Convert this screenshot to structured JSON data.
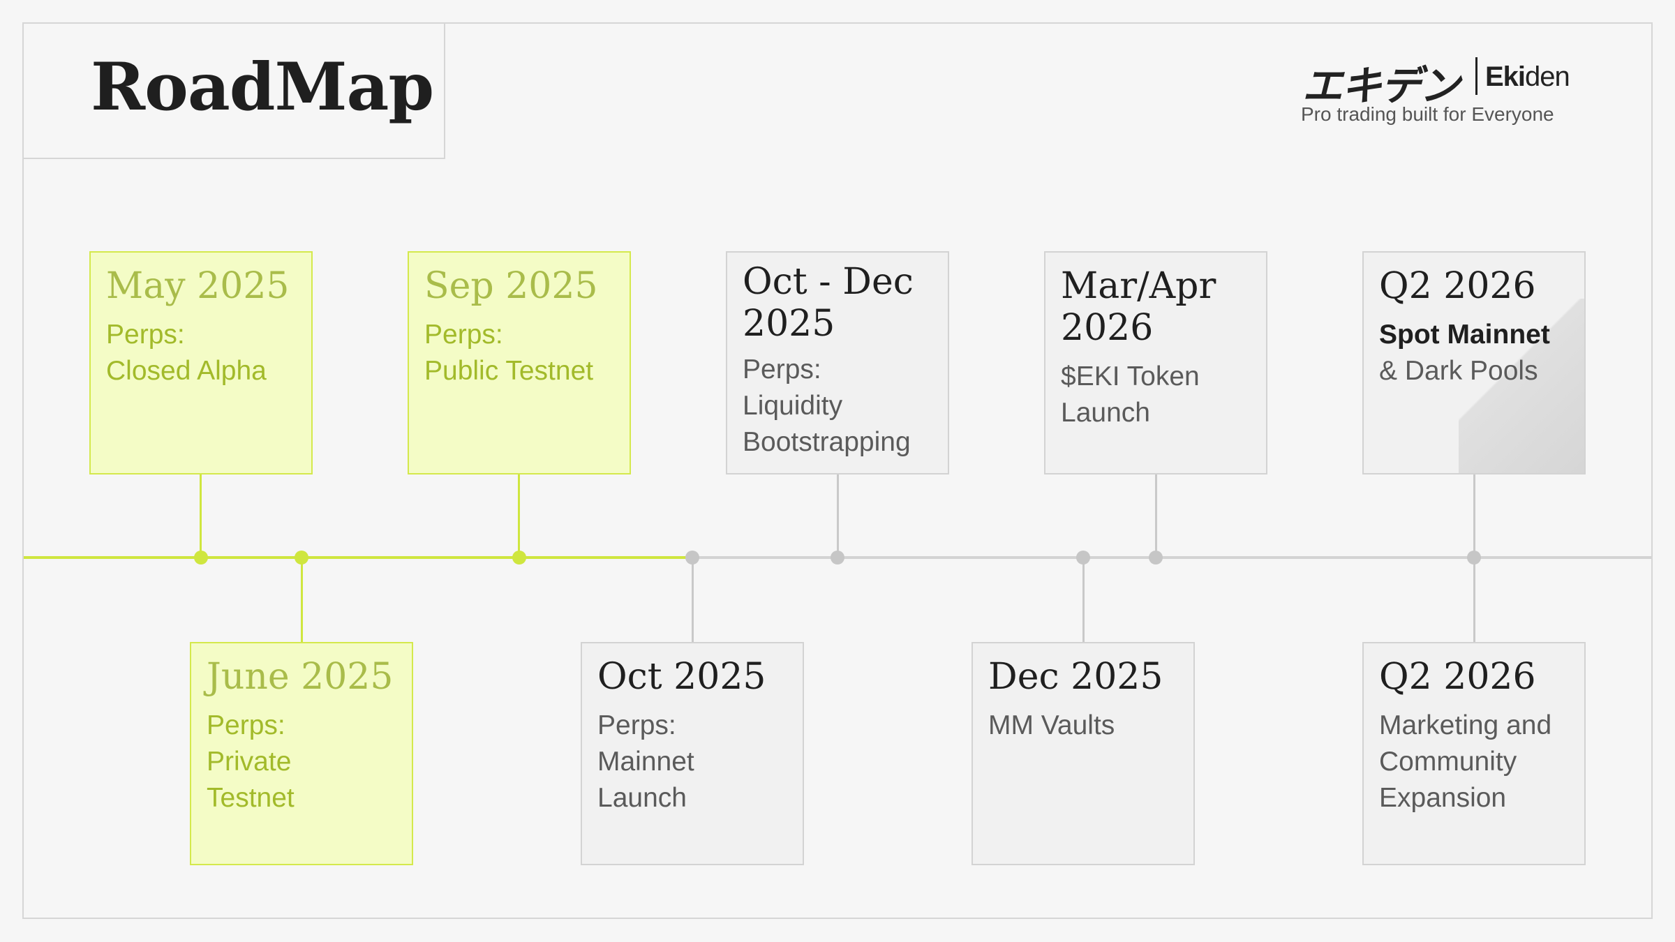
{
  "title": "RoadMap",
  "brand": {
    "jp": "エキデン",
    "en_bold": "Eki",
    "en_light": "den",
    "tagline": "Pro trading built for Everyone"
  },
  "colors": {
    "done_fill": "#f4fcc6",
    "done_border": "#d4e94c",
    "done_text": "#a2ba2a",
    "pending_fill": "#f1f1f1",
    "pending_border": "#d3d3d3",
    "timeline_done": "#cfe63f",
    "timeline_pending": "#d3d3d3"
  },
  "milestones": [
    {
      "date": "May 2025",
      "desc": "Perps:\nClosed Alpha",
      "status": "done",
      "row": "top"
    },
    {
      "date": "Sep 2025",
      "desc": "Perps:\nPublic Testnet",
      "status": "done",
      "row": "top"
    },
    {
      "date": "Oct - Dec\n2025",
      "desc": "Perps:\nLiquidity\nBootstrapping",
      "status": "pending",
      "row": "top"
    },
    {
      "date": "Mar/Apr\n2026",
      "desc": "$EKI Token\nLaunch",
      "status": "pending",
      "row": "top"
    },
    {
      "date": "Q2 2026",
      "desc_strong": "Spot Mainnet",
      "desc": " & Dark Pools",
      "status": "pending",
      "row": "top"
    },
    {
      "date": "June 2025",
      "desc": "Perps:\nPrivate\nTestnet",
      "status": "done",
      "row": "bottom"
    },
    {
      "date": "Oct 2025",
      "desc": "Perps:\nMainnet\nLaunch",
      "status": "pending",
      "row": "bottom"
    },
    {
      "date": "Dec 2025",
      "desc": "MM Vaults",
      "status": "pending",
      "row": "bottom"
    },
    {
      "date": "Q2 2026",
      "desc": "Marketing and\nCommunity\nExpansion",
      "status": "pending",
      "row": "bottom"
    }
  ]
}
